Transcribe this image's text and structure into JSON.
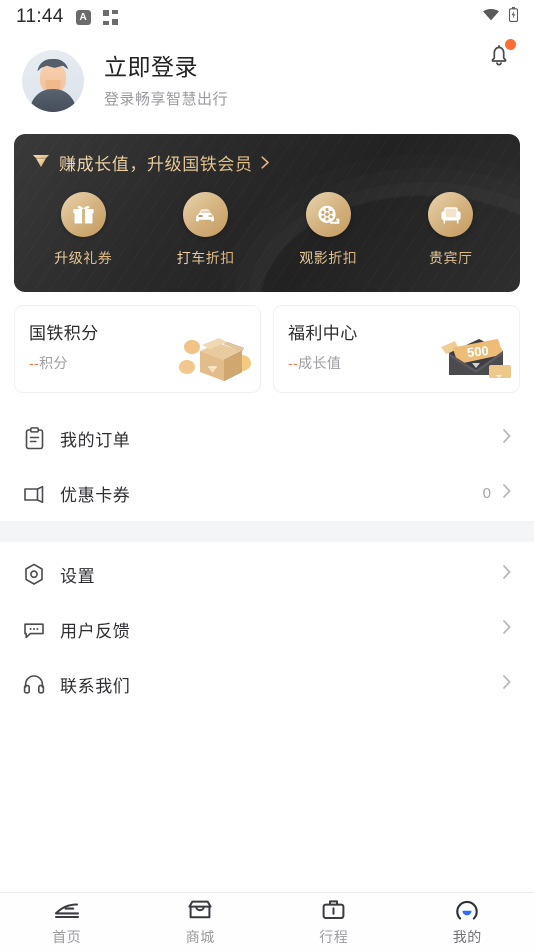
{
  "statusbar": {
    "time": "11:44",
    "icon_a_label": "A",
    "icons": [
      "app-badge-icon",
      "grid-icon",
      "wifi-icon",
      "battery-icon"
    ]
  },
  "header": {
    "bell_icon": "notification-bell-icon",
    "bell_has_badge": true,
    "badge_color": "#ff6b35"
  },
  "profile": {
    "avatar_icon": "default-user-avatar",
    "name": "立即登录",
    "subtitle": "登录畅享智慧出行"
  },
  "member_card": {
    "diamond_icon": "diamond-icon",
    "title": "赚成长值，升级国铁会员",
    "chevron_icon": "chevron-right-icon",
    "gold_color": "#e6c38c",
    "bg_color": "#2b2b2b",
    "benefits": [
      {
        "icon": "gift-icon",
        "label": "升级礼券"
      },
      {
        "icon": "car-icon",
        "label": "打车折扣"
      },
      {
        "icon": "film-reel-icon",
        "label": "观影折扣"
      },
      {
        "icon": "armchair-icon",
        "label": "贵宾厅"
      }
    ]
  },
  "stat_cards": [
    {
      "title": "国铁积分",
      "dash": "--",
      "unit": "积分",
      "art": "gift-box-coins-illustration"
    },
    {
      "title": "福利中心",
      "dash": "--",
      "unit": "成长值",
      "art": "envelope-voucher-illustration",
      "art_value": "500"
    }
  ],
  "menu_group_1": [
    {
      "icon": "clipboard-icon",
      "label": "我的订单",
      "count": "",
      "chevron": "chevron-right-icon"
    },
    {
      "icon": "ticket-icon",
      "label": "优惠卡券",
      "count": "0",
      "chevron": "chevron-right-icon"
    }
  ],
  "menu_group_2": [
    {
      "icon": "settings-gear-icon",
      "label": "设置",
      "chevron": "chevron-right-icon"
    },
    {
      "icon": "chat-bubble-icon",
      "label": "用户反馈",
      "chevron": "chevron-right-icon"
    },
    {
      "icon": "headphones-icon",
      "label": "联系我们",
      "chevron": "chevron-right-icon"
    }
  ],
  "tabbar": {
    "active_index": 3,
    "active_color": "#2f6bff",
    "items": [
      {
        "icon": "train-icon",
        "label": "首页"
      },
      {
        "icon": "shop-icon",
        "label": "商城"
      },
      {
        "icon": "briefcase-icon",
        "label": "行程"
      },
      {
        "icon": "person-icon",
        "label": "我的"
      }
    ]
  }
}
